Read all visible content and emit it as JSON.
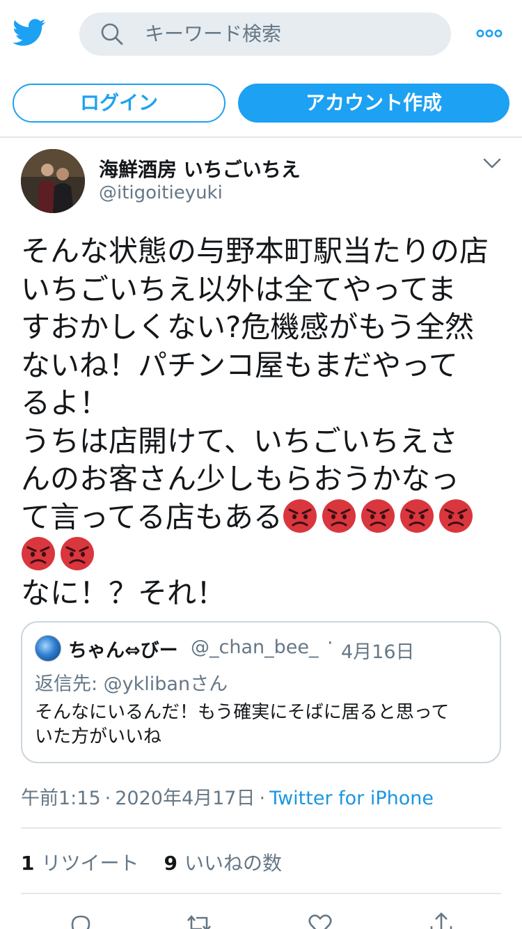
{
  "header": {
    "search_placeholder": "キーワード検索"
  },
  "auth": {
    "login_label": "ログイン",
    "signup_label": "アカウント作成"
  },
  "tweet": {
    "display_name": "海鮮酒房 いちごいちえ",
    "handle": "@itigoitieyuki",
    "lines": [
      "そんな状態の与野本町駅当たりの店",
      "いちごいちえ以外は全てやってま",
      "すおかしくない?危機感がもう全然",
      "ないね！パチンコ屋もまだやって",
      "るよ！",
      "うちは店開けて、いちごいちえさ",
      "んのお客さん少しもらおうかなっ",
      "て言ってる店もある"
    ],
    "last_line": "なに！？それ！",
    "emoji_name": "angry-face-icon",
    "emoji_count_line8": 5,
    "emoji_count_line9": 2
  },
  "quote": {
    "display_name": "ちゃん⇔びー",
    "handle": "@_chan_bee_",
    "dot": "·",
    "date": "4月16日",
    "reply_to": "返信先: @yklibanさん",
    "lines": [
      "そんなにいるんだ！もう確実にそばに居ると思って",
      "いた方がいいね"
    ]
  },
  "meta": {
    "time": "午前1:15",
    "sep": "·",
    "date": "2020年4月17日",
    "source": "Twitter for iPhone"
  },
  "stats": {
    "retweets": "1",
    "retweets_label": "リツイート",
    "likes": "9",
    "likes_label": "いいねの数"
  },
  "colors": {
    "accent": "#1da1f2",
    "secondary_text": "#657786",
    "divider": "#e1e8ed"
  }
}
